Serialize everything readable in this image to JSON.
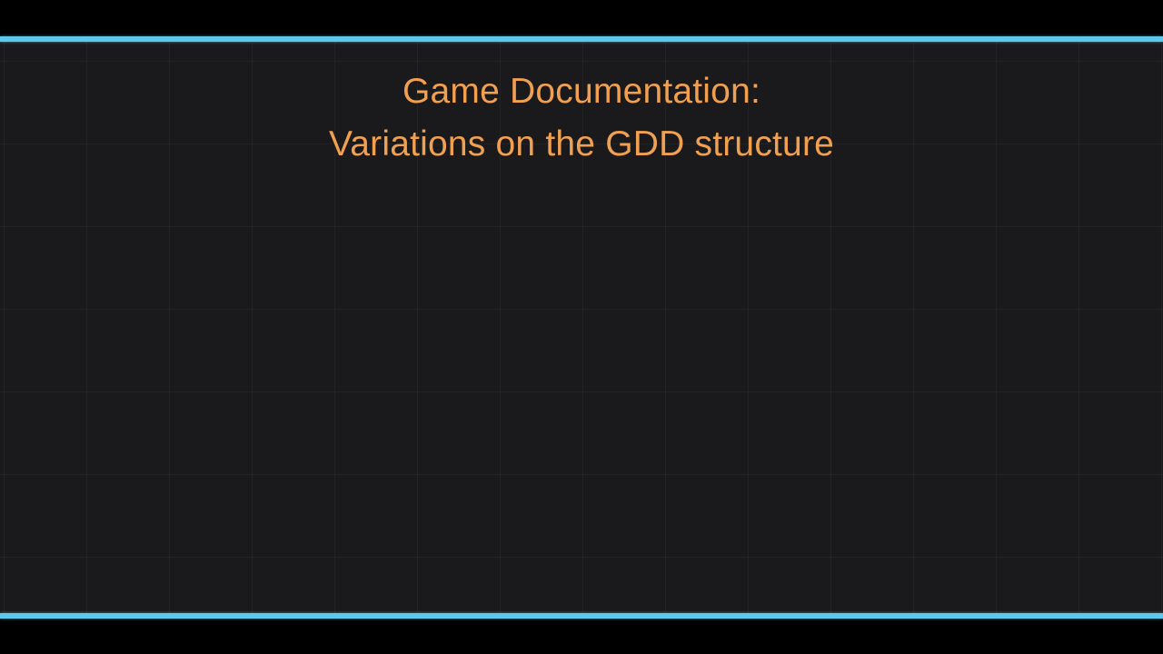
{
  "slide": {
    "title_line_1": "Game Documentation:",
    "title_line_2": "Variations on the GDD structure"
  },
  "colors": {
    "background": "#1a1a1c",
    "letterbox": "#000000",
    "accent_line": "#5cc8ec",
    "title_text": "#f0a050"
  }
}
